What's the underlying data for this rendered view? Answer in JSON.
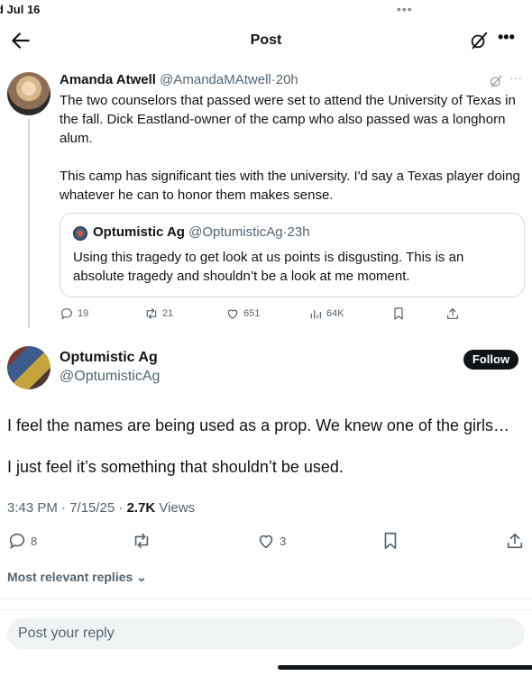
{
  "status_bar": {
    "time": "d Jul 16",
    "dots": "•••"
  },
  "header": {
    "title": "Post"
  },
  "parent_post": {
    "author_name": "Amanda Atwell",
    "handle": "@AmandaMAtwell",
    "separator": "·",
    "time": "20h",
    "more": "···",
    "paragraphs": [
      "The two counselors that passed were set to attend the University of Texas in the fall. Dick Eastland-owner of the camp who also passed was a longhorn alum.",
      "This camp has significant ties with the university. I'd say a Texas player doing whatever he can to honor them makes sense."
    ],
    "quote": {
      "author_name": "Optumistic Ag",
      "handle": "@OptumisticAg",
      "separator": "·",
      "time": "23h",
      "text": "Using this tragedy to get look at us points is disgusting. This is an absolute tragedy and shouldn’t be a look at me moment."
    },
    "stats": {
      "replies": "19",
      "reposts": "21",
      "likes": "651",
      "views": "64K"
    }
  },
  "main_post": {
    "author_name": "Optumistic Ag",
    "handle": "@OptumisticAg",
    "follow_label": "Follow",
    "paragraphs": [
      "I feel the names are being used as a prop. We knew one of the girls…",
      "I just feel it’s something that shouldn’t be used."
    ],
    "timestamp": "3:43 PM · 7/15/25 · ",
    "views_count": "2.7K",
    "views_label": " Views",
    "stats": {
      "replies": "8",
      "reposts": "",
      "likes": "3"
    }
  },
  "replies_sort": {
    "label": "Most relevant replies",
    "chevron": "⌄"
  },
  "reply_box": {
    "placeholder": "Post your reply"
  },
  "icons": {
    "back": "arrow-left-icon",
    "grok": "grok-icon",
    "more": "more-icon",
    "reply": "reply-icon",
    "repost": "repost-icon",
    "like": "heart-icon",
    "views": "views-icon",
    "bookmark": "bookmark-icon",
    "share": "share-icon"
  },
  "colors": {
    "text": "#0f1419",
    "muted": "#536471",
    "border": "#cfd9de",
    "follow_bg": "#0f1419"
  }
}
